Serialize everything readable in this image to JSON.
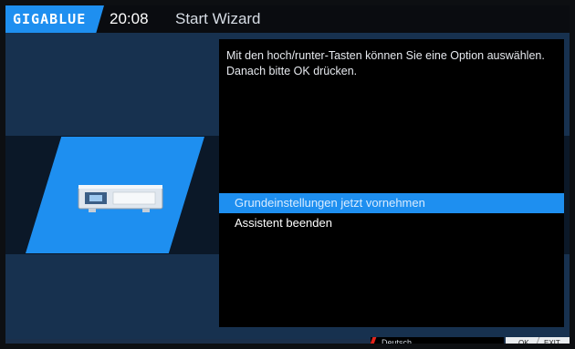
{
  "header": {
    "logo": "GIGABLUE",
    "time": "20:08",
    "title": "Start Wizard"
  },
  "panel": {
    "hint": "Mit den hoch/runter-Tasten können Sie eine Option auswählen. Danach bitte OK drücken.",
    "options": [
      {
        "label": "Grundeinstellungen jetzt vornehmen",
        "selected": true
      },
      {
        "label": "Assistent beenden",
        "selected": false
      }
    ]
  },
  "footer": {
    "language": "Deutsch",
    "ok": "OK",
    "exit": "EXIT"
  },
  "colors": {
    "accent": "#1e8ff0",
    "background": "#17314f",
    "panel": "#000000",
    "lang_marker": "#e2241b"
  },
  "icons": [
    "receiver-device-icon"
  ]
}
